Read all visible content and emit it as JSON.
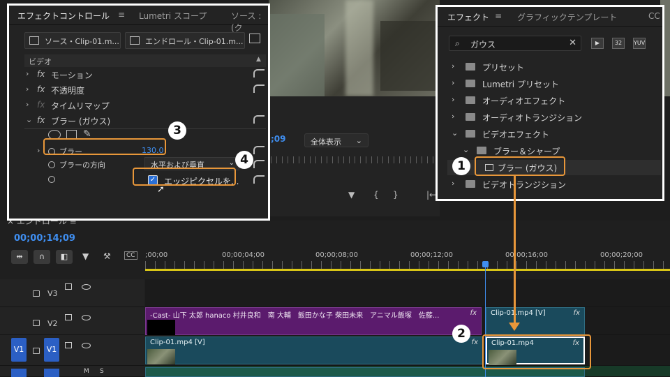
{
  "effect_controls": {
    "tabs": [
      "エフェクトコントロール",
      "Lumetri スコープ",
      "ソース : (ク"
    ],
    "menu_glyph": "≡",
    "source_button": "ソース・Clip-01.m...",
    "target_button": "エンドロール・Clip-01.m...",
    "section": "ビデオ",
    "rows": [
      {
        "chev": "›",
        "label": "モーション"
      },
      {
        "chev": "›",
        "label": "不透明度"
      },
      {
        "chev": "›",
        "label": "タイムリマップ"
      },
      {
        "chev": "⌄",
        "label": "ブラー (ガウス)"
      }
    ],
    "blur_label": "ブラー",
    "blur_value": "130.0",
    "direction_label": "ブラーの方向",
    "direction_value": "水平および垂直",
    "edge_pixels_label": "エッジピクセルを..."
  },
  "effects": {
    "tabs": [
      "エフェクト",
      "グラフィックテンプレート",
      "CC"
    ],
    "menu_glyph": "≡",
    "search_value": "ガウス",
    "icon_labels": [
      "32",
      "YUV"
    ],
    "tree": [
      {
        "chev": "›",
        "label": "プリセット",
        "level": 0
      },
      {
        "chev": "›",
        "label": "Lumetri プリセット",
        "level": 0
      },
      {
        "chev": "›",
        "label": "オーディオエフェクト",
        "level": 0
      },
      {
        "chev": "›",
        "label": "オーディオトランジション",
        "level": 0
      },
      {
        "chev": "⌄",
        "label": "ビデオエフェクト",
        "level": 0
      },
      {
        "chev": "⌄",
        "label": "ブラー＆シャープ",
        "level": 1
      },
      {
        "chev": "",
        "label": "ブラー (ガウス)",
        "level": 2
      },
      {
        "chev": "›",
        "label": "ビデオトランジション",
        "level": 0
      }
    ]
  },
  "program": {
    "timecode": ";09",
    "fit": "全体表示",
    "controls": [
      "▼",
      "{",
      "}",
      "|←"
    ]
  },
  "timeline": {
    "title": "× エンドロール ≡",
    "timecode": "00;00;14;09",
    "ruler": [
      ";00;00",
      "00;00;04;00",
      "00;00;08;00",
      "00;00;12;00",
      "00;00;16;00",
      "00;00;20;00"
    ],
    "tracks": [
      "V3",
      "V2",
      "V1"
    ],
    "credit_clip": "-Cast- 山下 太郎 hanaco 村井良和　南 大輔　飯田かな子 柴田未来　アニマル飯塚　佐藤...",
    "clip_v2": "Clip-01.mp4 [V]",
    "clip_v1": "Clip-01.mp4 [V]",
    "clip_v1_right": "Clip-01.mp4",
    "fx": "fx",
    "src_v1": "V1",
    "bottom_labels": [
      "M",
      "S"
    ]
  },
  "badges": [
    "1",
    "2",
    "3",
    "4"
  ],
  "colors": {
    "accent": "#3f8ef0",
    "highlight": "#e8973a",
    "clip_purple": "#5b1b6d",
    "clip_teal": "#1a4a5c"
  }
}
